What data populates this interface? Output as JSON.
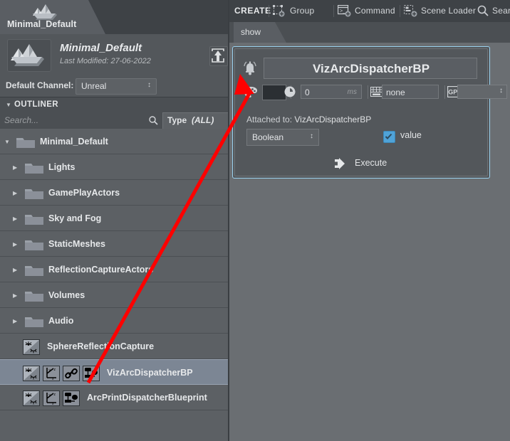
{
  "scene_tab": {
    "label": "Minimal_Default",
    "icon": "scene-mountains-icon"
  },
  "scene_header": {
    "name": "Minimal_Default",
    "modified": "Last Modified: 27-06-2022",
    "thumb_icon": "scene-mountains-icon",
    "export_icon": "upload-export-icon"
  },
  "channel": {
    "label": "Default Channel:",
    "value": "Unreal",
    "spinner": "↕"
  },
  "outliner": {
    "title": "OUTLINER",
    "caret": "▼",
    "search_placeholder": "Search...",
    "search_icon": "search-icon",
    "filter_label": "Type",
    "filter_value": "(ALL)",
    "rows": [
      {
        "label": "Minimal_Default",
        "depth": 0,
        "twisty": "▼",
        "kind": "folder",
        "icons": [],
        "selected": false
      },
      {
        "label": "Lights",
        "depth": 1,
        "twisty": "▶",
        "kind": "folder",
        "icons": [],
        "selected": false
      },
      {
        "label": "GamePlayActors",
        "depth": 1,
        "twisty": "▶",
        "kind": "folder",
        "icons": [],
        "selected": false
      },
      {
        "label": "Sky and Fog",
        "depth": 1,
        "twisty": "▶",
        "kind": "folder",
        "icons": [],
        "selected": false
      },
      {
        "label": "StaticMeshes",
        "depth": 1,
        "twisty": "▶",
        "kind": "folder",
        "icons": [],
        "selected": false
      },
      {
        "label": "ReflectionCaptureActors",
        "depth": 1,
        "twisty": "▶",
        "kind": "folder",
        "icons": [],
        "selected": false
      },
      {
        "label": "Volumes",
        "depth": 1,
        "twisty": "▶",
        "kind": "folder",
        "icons": [],
        "selected": false
      },
      {
        "label": "Audio",
        "depth": 1,
        "twisty": "▶",
        "kind": "folder",
        "icons": [],
        "selected": false
      },
      {
        "label": "SphereReflectionCapture",
        "depth": 1,
        "twisty": "",
        "kind": "actor",
        "icons": [
          "visibility-eye-icon"
        ],
        "selected": false
      },
      {
        "label": "VizArcDispatcherBP",
        "depth": 1,
        "twisty": "",
        "kind": "actor",
        "icons": [
          "visibility-eye-icon",
          "transform-axis-icon",
          "link-chain-icon",
          "blueprint-nodes-icon"
        ],
        "selected": true
      },
      {
        "label": "ArcPrintDispatcherBlueprint",
        "depth": 1,
        "twisty": "",
        "kind": "actor",
        "icons": [
          "visibility-eye-icon",
          "transform-axis-icon",
          "blueprint-nodes-icon"
        ],
        "selected": false
      }
    ]
  },
  "toolbar": {
    "create_label": "CREATE",
    "items": [
      {
        "label": "Group",
        "icon": "add-group-icon"
      },
      {
        "label": "Command",
        "icon": "add-command-icon"
      },
      {
        "label": "Scene Loader",
        "icon": "add-scene-loader-icon"
      },
      {
        "label": "Search",
        "icon": "search-icon"
      }
    ]
  },
  "tabs": [
    {
      "label": "show",
      "active": true
    }
  ],
  "dispatcher": {
    "bell_icon": "notification-bell-icon",
    "title": "VizArcDispatcherBP",
    "palette_icon": "color-palette-icon",
    "color_value": "#2b2f33",
    "clock_icon": "clock-delay-icon",
    "delay_value": "0",
    "delay_unit": "ms",
    "keyboard_icon": "keyboard-shortcut-icon",
    "shortcut_value": "none",
    "gpi_icon": "gpi-icon",
    "gpi_value": "",
    "gpi_spinner": "↕",
    "attached_label": "Attached to:",
    "attached_value": "VizArcDispatcherBP",
    "type_value": "Boolean",
    "type_spinner": "↕",
    "value_checkbox_label": "value",
    "value_checked": true,
    "execute_label": "Execute",
    "execute_icon": "execute-play-icon",
    "selection_border_color": "#9ad2ef"
  },
  "annotation": {
    "arrow_color": "#ff0000",
    "points_to": "notification-bell-icon"
  }
}
